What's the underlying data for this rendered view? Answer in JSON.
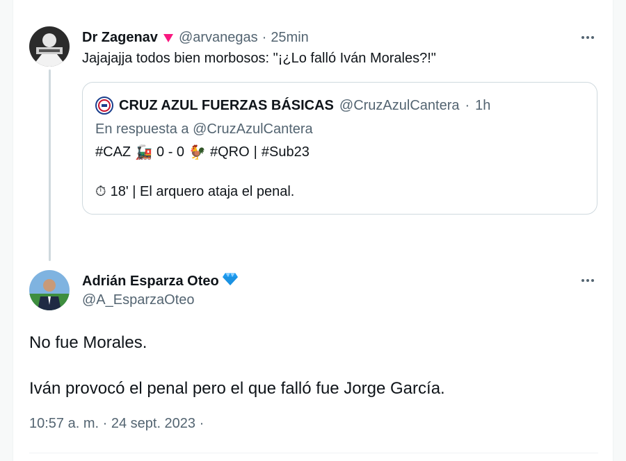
{
  "reply_tweet": {
    "display_name": "Dr Zagenav",
    "handle": "@arvanegas",
    "separator": "·",
    "time": "25min",
    "text": "Jajajajja todos bien morbosos: \"¡¿Lo falló Iván Morales?!\"",
    "icons": {
      "avatar": "avatar-photo",
      "badge": "red-heart-icon",
      "more": "more-options-icon"
    },
    "quoted": {
      "display_name": "CRUZ AZUL FUERZAS BÁSICAS",
      "handle": "@CruzAzulCantera",
      "separator": "·",
      "time": "1h",
      "reply_context": "En respuesta a @CruzAzulCantera",
      "score": {
        "home": "#CAZ",
        "home_icon": "🚂",
        "result": "0 - 0",
        "away_icon": "🐓",
        "away": "#QRO",
        "divider": "|",
        "category": "#Sub23"
      },
      "minute_icon": "⏱",
      "minute_text": "18' | El arquero ataja el penal."
    }
  },
  "main_tweet": {
    "display_name": "Adrián Esparza Oteo",
    "badge_icon": "blue-diamond-icon",
    "handle": "@A_EsparzaOteo",
    "paragraph_1": "No fue Morales.",
    "paragraph_2": "Iván provocó el penal pero el que falló fue Jorge García.",
    "timestamp": "10:57 a. m. · 24 sept. 2023 ·"
  },
  "colors": {
    "text": "#0f1419",
    "secondary": "#536471",
    "border": "#cfd9de",
    "thread_line": "#cfd9de",
    "heart": "#f91880",
    "diamond": "#1d9bf0"
  }
}
